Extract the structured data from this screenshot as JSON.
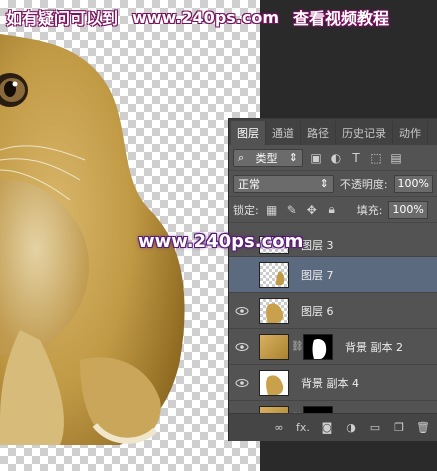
{
  "watermark": {
    "top_left": "如有疑问可以到",
    "top_url": "www.240ps.com",
    "top_right": "查看视频教程",
    "middle_url": "www.240ps.com"
  },
  "panel": {
    "tabs": [
      "图层",
      "通道",
      "路径",
      "历史记录",
      "动作"
    ],
    "active_tab": "图层",
    "filter": {
      "label": "类型",
      "icons": [
        "image-filter-icon",
        "adjustment-filter-icon",
        "type-filter-icon",
        "shape-filter-icon",
        "smart-object-filter-icon"
      ]
    },
    "blend_mode": "正常",
    "opacity_label": "不透明度:",
    "opacity_value": "100%",
    "lock_label": "锁定:",
    "fill_label": "填充:",
    "fill_value": "100%",
    "layers": [
      {
        "name": "图层 3",
        "thumb": "checker",
        "selected": false
      },
      {
        "name": "图层 7",
        "thumb": "checker",
        "selected": true
      },
      {
        "name": "图层 6",
        "thumb": "cat",
        "selected": false
      },
      {
        "name": "背景 副本 2",
        "thumb": "photo-with-mask",
        "selected": false
      },
      {
        "name": "背景 副本 4",
        "thumb": "cat",
        "selected": false
      },
      {
        "name": "",
        "thumb": "photo-with-mask",
        "selected": false
      }
    ],
    "bottom_icons": [
      "link-layers-icon",
      "fx-icon",
      "add-mask-icon",
      "adjustment-layer-icon",
      "new-group-icon",
      "new-layer-icon",
      "delete-layer-icon"
    ],
    "fx_label": "fx."
  },
  "colors": {
    "panel_bg": "#535353",
    "selected_layer": "#5c6a80",
    "watermark_outline": "#7a0f5f"
  }
}
